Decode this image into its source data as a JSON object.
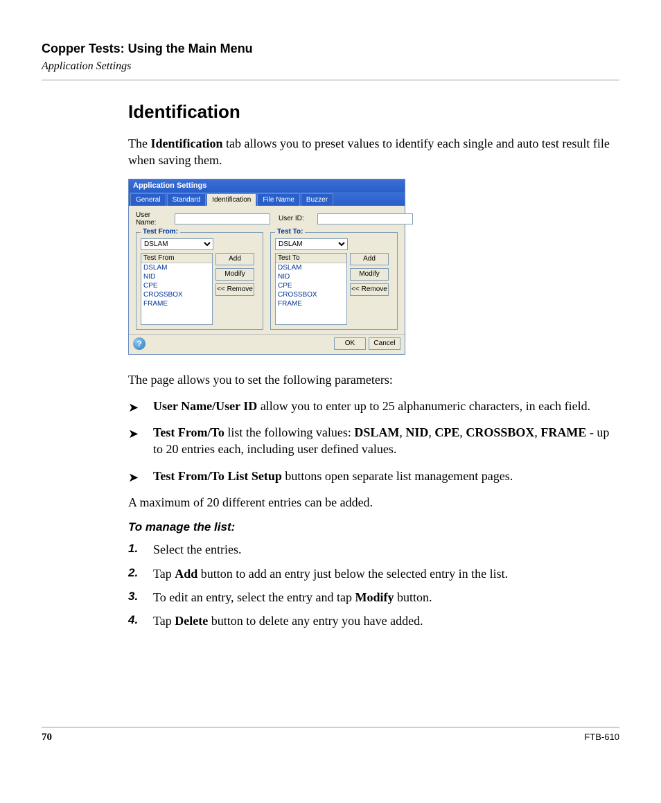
{
  "header": {
    "chapter": "Copper Tests: Using the Main Menu",
    "section": "Application Settings"
  },
  "heading": "Identification",
  "intro_pre": "The ",
  "intro_bold": "Identification",
  "intro_post": " tab allows you to preset values to identify each single and auto test result file when saving them.",
  "dialog": {
    "title": "Application Settings",
    "tabs": [
      "General",
      "Standard",
      "Identification",
      "File Name",
      "Buzzer"
    ],
    "active_tab": "Identification",
    "user_name_label": "User Name:",
    "user_id_label": "User ID:",
    "test_from": {
      "legend": "Test From:",
      "selected": "DSLAM",
      "list_header": "Test From",
      "items": [
        "DSLAM",
        "NID",
        "CPE",
        "CROSSBOX",
        "FRAME"
      ]
    },
    "test_to": {
      "legend": "Test To:",
      "selected": "DSLAM",
      "list_header": "Test To",
      "items": [
        "DSLAM",
        "NID",
        "CPE",
        "CROSSBOX",
        "FRAME"
      ]
    },
    "buttons": {
      "add": "Add",
      "modify": "Modify",
      "remove": "<< Remove"
    },
    "ok": "OK",
    "cancel": "Cancel"
  },
  "params_intro": "The page allows you to set the following parameters:",
  "bullets": [
    {
      "b": "User Name/User ID",
      "t": " allow you to enter up to 25 alphanumeric characters, in each field."
    },
    {
      "b": "Test From/To",
      "t1": " list the following values: ",
      "vals": "DSLAM, NID, CPE, CROSSBOX, FRAME",
      "t2": " - up to 20 entries each, including user defined values."
    },
    {
      "b": "Test From/To List Setup",
      "t": " buttons open separate list management pages."
    }
  ],
  "value_tokens": {
    "v1": "DSLAM",
    "v2": "NID",
    "v3": "CPE",
    "v4": "CROSSBOX",
    "v5": "FRAME"
  },
  "max_line": "A maximum of 20 different entries can be added.",
  "manage_head": "To manage the list:",
  "steps": {
    "s1": "Select the entries.",
    "s2a": "Tap ",
    "s2b": "Add",
    "s2c": " button to add an entry just below the selected entry in the list.",
    "s3a": "To edit an entry, select the entry and tap ",
    "s3b": "Modify",
    "s3c": " button.",
    "s4a": "Tap ",
    "s4b": "Delete",
    "s4c": " button to delete any entry you have added."
  },
  "footer": {
    "page": "70",
    "doc": "FTB-610"
  }
}
